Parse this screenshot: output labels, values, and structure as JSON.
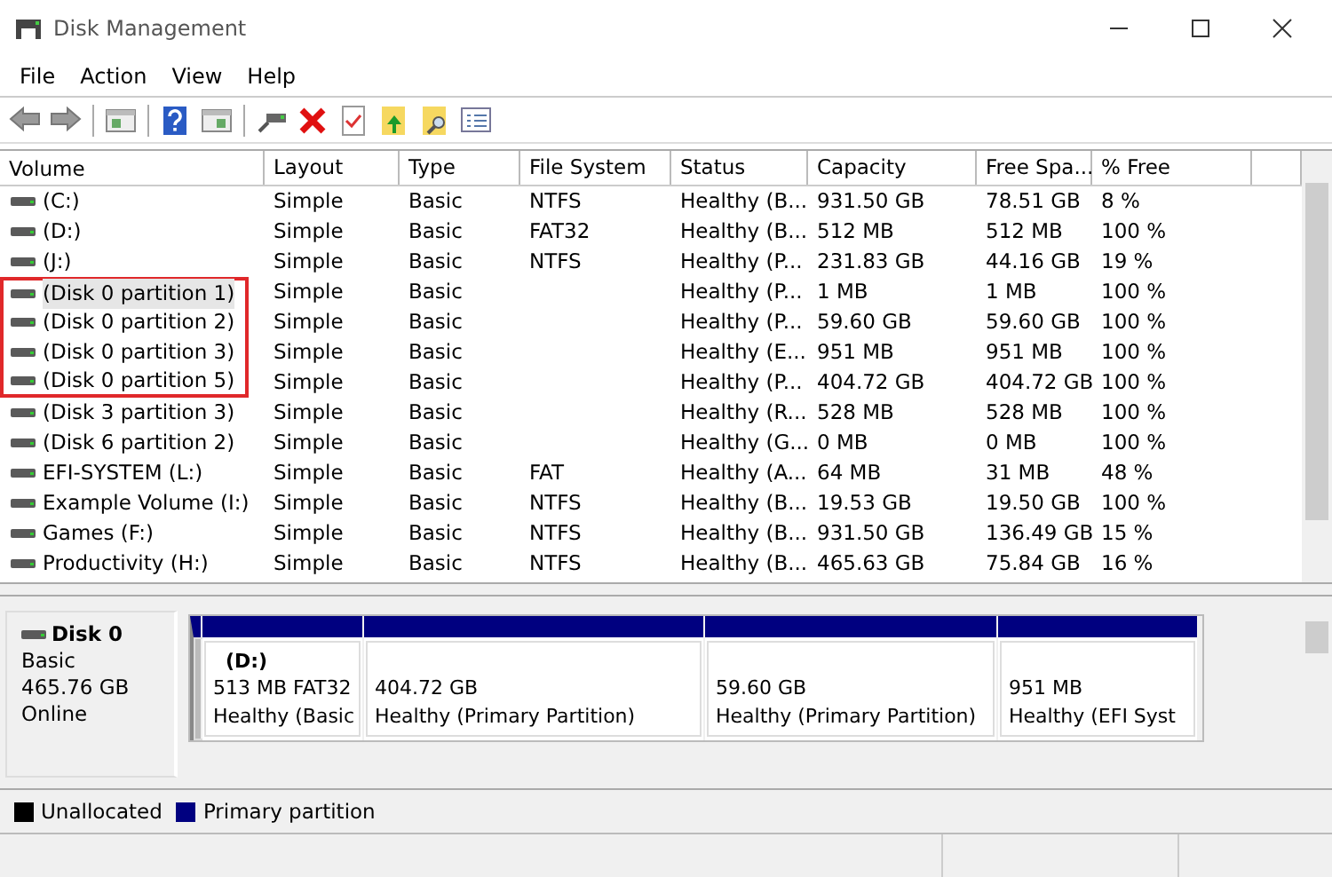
{
  "window": {
    "title": "Disk Management"
  },
  "menu": [
    "File",
    "Action",
    "View",
    "Help"
  ],
  "table": {
    "columns": [
      "Volume",
      "Layout",
      "Type",
      "File System",
      "Status",
      "Capacity",
      "Free Spa...",
      "% Free"
    ],
    "rows": [
      {
        "cells": [
          "(C:)",
          "Simple",
          "Basic",
          "NTFS",
          "Healthy (B...",
          "931.50 GB",
          "78.51 GB",
          "8 %"
        ],
        "selected": false,
        "highlighted": false
      },
      {
        "cells": [
          "(D:)",
          "Simple",
          "Basic",
          "FAT32",
          "Healthy (B...",
          "512 MB",
          "512 MB",
          "100 %"
        ],
        "selected": false,
        "highlighted": false
      },
      {
        "cells": [
          "(J:)",
          "Simple",
          "Basic",
          "NTFS",
          "Healthy (P...",
          "231.83 GB",
          "44.16 GB",
          "19 %"
        ],
        "selected": false,
        "highlighted": false
      },
      {
        "cells": [
          "(Disk 0 partition 1)",
          "Simple",
          "Basic",
          "",
          "Healthy (P...",
          "1 MB",
          "1 MB",
          "100 %"
        ],
        "selected": true,
        "highlighted": true
      },
      {
        "cells": [
          "(Disk 0 partition 2)",
          "Simple",
          "Basic",
          "",
          "Healthy (P...",
          "59.60 GB",
          "59.60 GB",
          "100 %"
        ],
        "selected": false,
        "highlighted": true
      },
      {
        "cells": [
          "(Disk 0 partition 3)",
          "Simple",
          "Basic",
          "",
          "Healthy (E...",
          "951 MB",
          "951 MB",
          "100 %"
        ],
        "selected": false,
        "highlighted": true
      },
      {
        "cells": [
          "(Disk 0 partition 5)",
          "Simple",
          "Basic",
          "",
          "Healthy (P...",
          "404.72 GB",
          "404.72 GB",
          "100 %"
        ],
        "selected": false,
        "highlighted": true
      },
      {
        "cells": [
          "(Disk 3 partition 3)",
          "Simple",
          "Basic",
          "",
          "Healthy (R...",
          "528 MB",
          "528 MB",
          "100 %"
        ],
        "selected": false,
        "highlighted": false
      },
      {
        "cells": [
          "(Disk 6 partition 2)",
          "Simple",
          "Basic",
          "",
          "Healthy (G...",
          "0 MB",
          "0 MB",
          "100 %"
        ],
        "selected": false,
        "highlighted": false
      },
      {
        "cells": [
          "EFI-SYSTEM (L:)",
          "Simple",
          "Basic",
          "FAT",
          "Healthy (A...",
          "64 MB",
          "31 MB",
          "48 %"
        ],
        "selected": false,
        "highlighted": false
      },
      {
        "cells": [
          "Example Volume (I:)",
          "Simple",
          "Basic",
          "NTFS",
          "Healthy (B...",
          "19.53 GB",
          "19.50 GB",
          "100 %"
        ],
        "selected": false,
        "highlighted": false
      },
      {
        "cells": [
          "Games (F:)",
          "Simple",
          "Basic",
          "NTFS",
          "Healthy (B...",
          "931.50 GB",
          "136.49 GB",
          "15 %"
        ],
        "selected": false,
        "highlighted": false
      },
      {
        "cells": [
          "Productivity (H:)",
          "Simple",
          "Basic",
          "NTFS",
          "Healthy (B...",
          "465.63 GB",
          "75.84 GB",
          "16 %"
        ],
        "selected": false,
        "highlighted": false
      }
    ]
  },
  "disk": {
    "name": "Disk 0",
    "lines": [
      "Basic",
      "465.76 GB",
      "Online"
    ],
    "partitions": [
      {
        "kind": "sliver"
      },
      {
        "kind": "volume",
        "title": "(D:)",
        "lines": [
          "513 MB FAT32",
          "Healthy (Basic"
        ]
      },
      {
        "kind": "volume",
        "lines": [
          "404.72 GB",
          "Healthy (Primary Partition)"
        ]
      },
      {
        "kind": "volume",
        "lines": [
          "59.60 GB",
          "Healthy (Primary Partition)"
        ]
      },
      {
        "kind": "volume",
        "lines": [
          "951 MB",
          "Healthy (EFI Syst"
        ]
      }
    ]
  },
  "legend": [
    {
      "label": "Unallocated",
      "color": "#000000"
    },
    {
      "label": "Primary partition",
      "color": "#000080"
    }
  ]
}
